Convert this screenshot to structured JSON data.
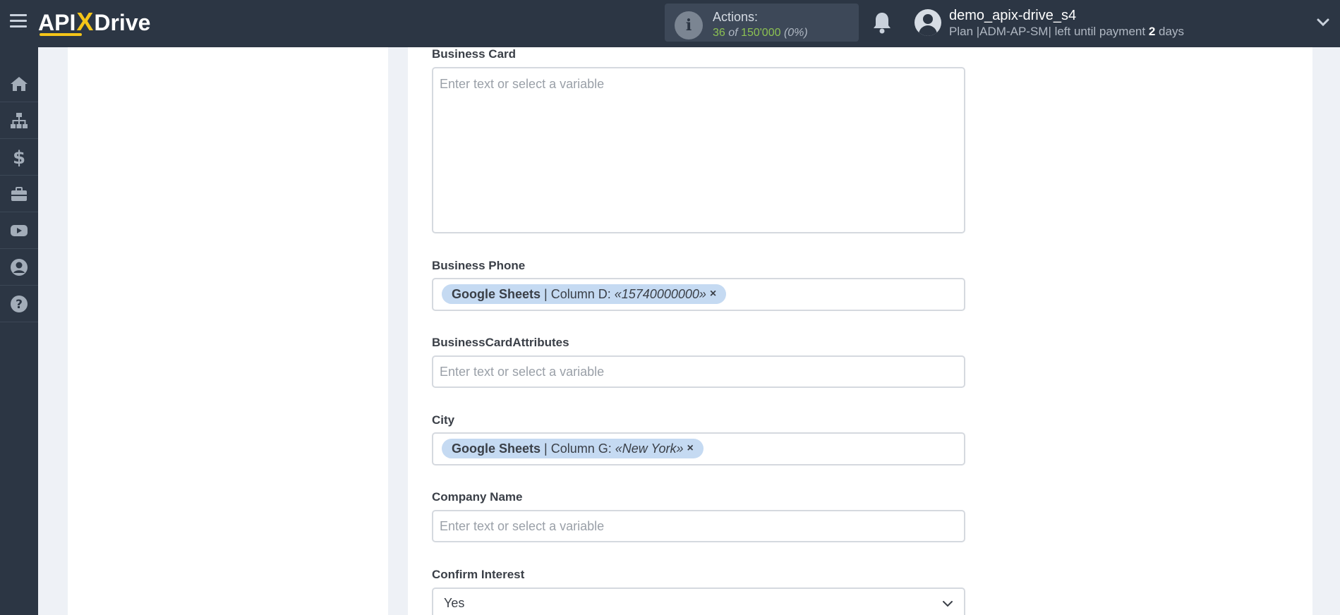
{
  "header": {
    "logo": {
      "part1": "API",
      "x": "X",
      "part2": "Drive"
    },
    "actions": {
      "label": "Actions:",
      "used": "36",
      "of": "of",
      "total": "150'000",
      "percent": "(0%)"
    },
    "user": {
      "name": "demo_apix-drive_s4",
      "plan_prefix": "Plan |ADM-AP-SM| left until payment",
      "days_num": "2",
      "days_word": "days"
    }
  },
  "sidebar": {
    "items": [
      "home-icon",
      "sitemap-icon",
      "dollar-icon",
      "briefcase-icon",
      "youtube-icon",
      "user-circle-icon",
      "help-icon"
    ]
  },
  "form": {
    "business_card": {
      "label": "Business Card",
      "placeholder": "Enter text or select a variable"
    },
    "business_phone": {
      "label": "Business Phone",
      "chip": {
        "source": "Google Sheets",
        "separator": "|",
        "column": "Column D:",
        "value": "«15740000000»",
        "remove": "×"
      }
    },
    "business_card_attributes": {
      "label": "BusinessCardAttributes",
      "placeholder": "Enter text or select a variable"
    },
    "city": {
      "label": "City",
      "chip": {
        "source": "Google Sheets",
        "separator": "|",
        "column": "Column G:",
        "value": "«New York»",
        "remove": "×"
      }
    },
    "company_name": {
      "label": "Company Name",
      "placeholder": "Enter text or select a variable"
    },
    "confirm_interest": {
      "label": "Confirm Interest",
      "value": "Yes"
    }
  },
  "colors": {
    "topbar": "#2c3644",
    "accent_yellow": "#f5c518",
    "actions_green": "#8cc152",
    "chip_bg": "#c5daf2"
  }
}
